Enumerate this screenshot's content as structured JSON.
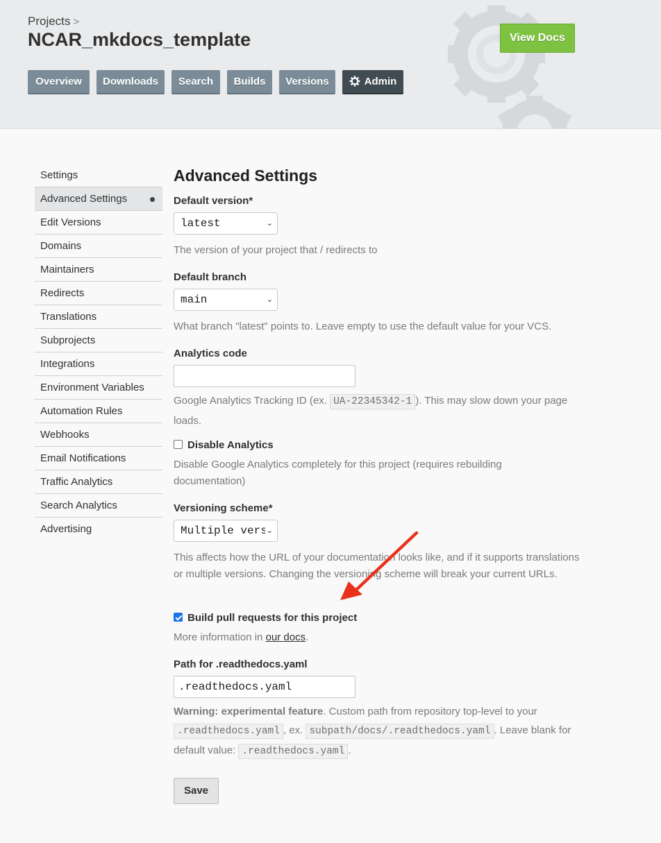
{
  "header": {
    "breadcrumb": "Projects",
    "breadcrumb_sep": ">",
    "project_name": "NCAR_mkdocs_template",
    "view_docs_label": "View Docs",
    "nav": [
      "Overview",
      "Downloads",
      "Search",
      "Builds",
      "Versions",
      "Admin"
    ]
  },
  "sidebar": {
    "items": [
      "Settings",
      "Advanced Settings",
      "Edit Versions",
      "Domains",
      "Maintainers",
      "Redirects",
      "Translations",
      "Subprojects",
      "Integrations",
      "Environment Variables",
      "Automation Rules",
      "Webhooks",
      "Email Notifications",
      "Traffic Analytics",
      "Search Analytics",
      "Advertising"
    ],
    "active": "Advanced Settings"
  },
  "form": {
    "title": "Advanced Settings",
    "default_version": {
      "label": "Default version*",
      "value": "latest",
      "help": "The version of your project that / redirects to"
    },
    "default_branch": {
      "label": "Default branch",
      "value": "main",
      "help": "What branch \"latest\" points to. Leave empty to use the default value for your VCS."
    },
    "analytics_code": {
      "label": "Analytics code",
      "value": "",
      "help_pre": "Google Analytics Tracking ID (ex. ",
      "help_code": "UA-22345342-1",
      "help_post": "). This may slow down your page loads."
    },
    "disable_analytics": {
      "label": "Disable Analytics",
      "checked": false,
      "help": "Disable Google Analytics completely for this project (requires rebuilding documentation)"
    },
    "versioning_scheme": {
      "label": "Versioning scheme*",
      "value": "Multiple vers",
      "help": "This affects how the URL of your documentation looks like, and if it supports translations or multiple versions. Changing the versioning scheme will break your current URLs."
    },
    "build_prs": {
      "label": "Build pull requests for this project",
      "checked": true,
      "help_pre": "More information in ",
      "help_link": "our docs",
      "help_post": "."
    },
    "readthedocs_path": {
      "label": "Path for .readthedocs.yaml",
      "value": ".readthedocs.yaml",
      "warn_strong": "Warning: experimental feature",
      "warn_1": ". Custom path from repository top-level to your",
      "code_1": ".readthedocs.yaml",
      "warn_2": ", ex.",
      "code_2": "subpath/docs/.readthedocs.yaml",
      "warn_3": ". Leave blank for default value:",
      "code_3": ".readthedocs.yaml",
      "warn_4": "."
    },
    "save_label": "Save"
  },
  "colors": {
    "view_docs_green": "#7ec241",
    "nav_button": "#7b8c98",
    "admin_button": "#414b52",
    "arrow_red": "#e8321c"
  }
}
